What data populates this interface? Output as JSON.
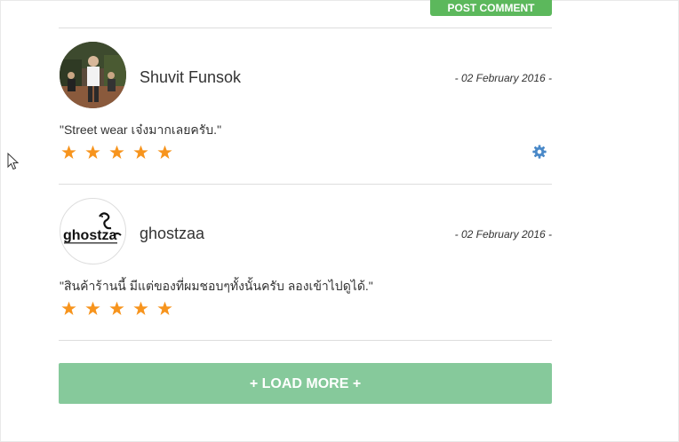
{
  "post_comment": {
    "label": "POST COMMENT"
  },
  "reviews": [
    {
      "author": "Shuvit Funsok",
      "date": "- 02 February 2016 -",
      "text": "\"Street wear เจ๋งมากเลยครับ.\"",
      "rating": 5,
      "avatar_icon": "user-photo",
      "settings_icon": "gear-icon"
    },
    {
      "author": "ghostzaa",
      "date": "- 02 February 2016 -",
      "text": "\"สินค้าร้านนี้ มีแต่ของที่ผมชอบๆทั้งนั้นครับ ลองเข้าไปดูได้.\"",
      "rating": 5,
      "avatar_icon": "ghostzaa-logo",
      "avatar_logo_text": "ghostza"
    }
  ],
  "load_more": {
    "label": "+ LOAD MORE +"
  },
  "colors": {
    "star": "#f7941d",
    "post_button": "#5cb85c",
    "load_more": "#86c99b",
    "gear": "#4a89c8"
  }
}
